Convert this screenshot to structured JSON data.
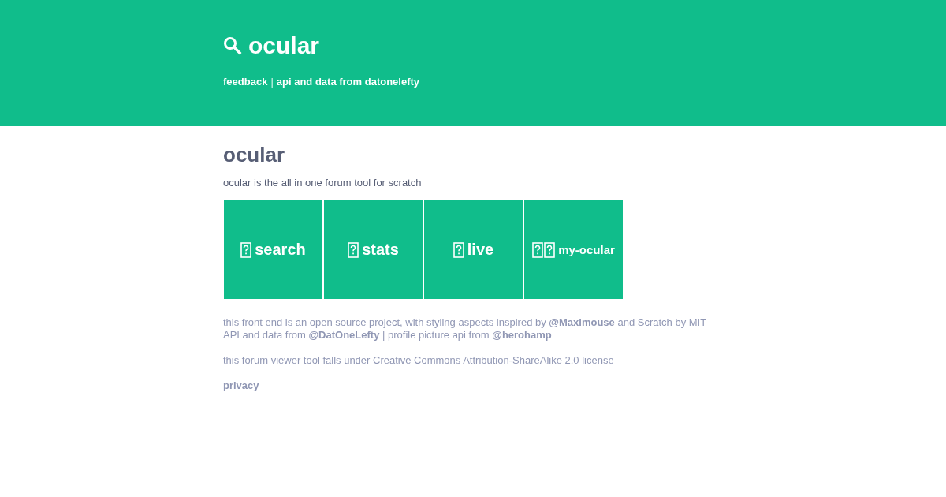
{
  "header": {
    "title": "ocular",
    "nav": [
      {
        "kind": "link",
        "text": "feedback"
      },
      {
        "kind": "separator",
        "text": "|"
      },
      {
        "kind": "link",
        "text": "api and data from datonelefty"
      }
    ]
  },
  "intro": {
    "heading": "ocular",
    "description": "ocular is the all in one forum tool for scratch"
  },
  "tiles": [
    {
      "label": "search",
      "icons": [
        {
          "kind": "missing"
        }
      ]
    },
    {
      "label": "stats",
      "icons": [
        {
          "kind": "missing"
        }
      ]
    },
    {
      "label": "live",
      "icons": [
        {
          "kind": "missing"
        }
      ]
    },
    {
      "label": "my-ocular",
      "icons": [
        {
          "kind": "missing"
        },
        {
          "kind": "missing"
        }
      ]
    }
  ],
  "footer": {
    "credits": [
      [
        {
          "kind": "text",
          "text": "this front end is an open source project, with styling aspects inspired by "
        },
        {
          "kind": "link",
          "text": "@Maximouse"
        },
        {
          "kind": "text",
          "text": " and Scratch by MIT"
        }
      ],
      [
        {
          "kind": "text",
          "text": "API and data from "
        },
        {
          "kind": "link",
          "text": "@DatOneLefty"
        },
        {
          "kind": "text",
          "text": " | profile picture api from "
        },
        {
          "kind": "link",
          "text": "@herohamp"
        }
      ]
    ],
    "license": "this forum viewer tool falls under Creative Commons Attribution-ShareAlike 2.0 license",
    "privacy": "privacy"
  }
}
